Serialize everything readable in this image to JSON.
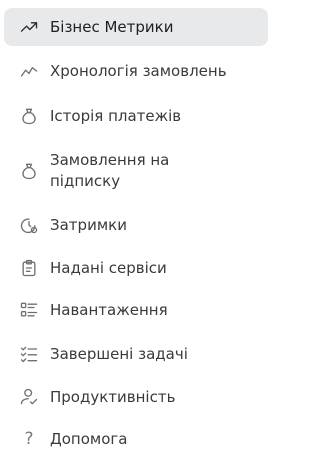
{
  "nav": {
    "items": [
      {
        "label": "Бізнес Метрики",
        "icon": "trending-up-icon",
        "active": true
      },
      {
        "label": "Хронологія замовлень",
        "icon": "line-chart-icon",
        "active": false
      },
      {
        "label": "Історія платежів",
        "icon": "money-bag-icon",
        "active": false
      },
      {
        "label": "Замовлення на підписку",
        "icon": "money-bag-icon",
        "active": false
      },
      {
        "label": "Затримки",
        "icon": "clock-alert-icon",
        "active": false
      },
      {
        "label": "Надані сервіси",
        "icon": "clipboard-icon",
        "active": false
      },
      {
        "label": "Навантаження",
        "icon": "list-icon",
        "active": false
      },
      {
        "label": "Завершені задачі",
        "icon": "checklist-icon",
        "active": false
      },
      {
        "label": "Продуктивність",
        "icon": "user-check-icon",
        "active": false
      },
      {
        "label": "Допомога",
        "icon": "help-icon",
        "active": false
      }
    ]
  }
}
